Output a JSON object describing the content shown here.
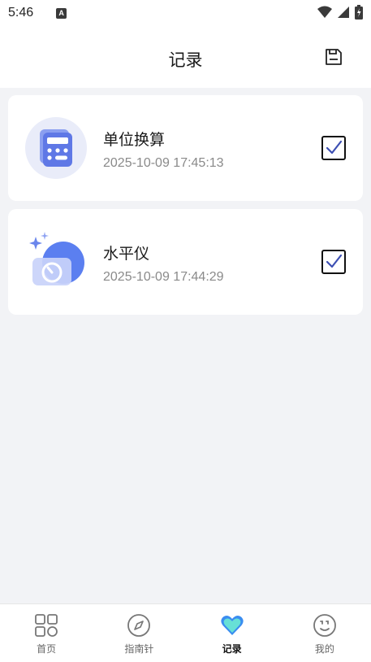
{
  "status_bar": {
    "time": "5:46",
    "notification_badge": "A"
  },
  "header": {
    "title": "记录",
    "save_icon": "save-icon"
  },
  "records": [
    {
      "title": "单位换算",
      "timestamp": "2025-10-09 17:45:13",
      "icon": "calculator-icon",
      "checked": true
    },
    {
      "title": "水平仪",
      "timestamp": "2025-10-09 17:44:29",
      "icon": "level-icon",
      "checked": true
    }
  ],
  "tabbar": {
    "tabs": [
      {
        "label": "首页",
        "icon": "home-grid-icon",
        "active": false
      },
      {
        "label": "指南针",
        "icon": "compass-icon",
        "active": false
      },
      {
        "label": "记录",
        "icon": "heart-icon",
        "active": true
      },
      {
        "label": "我的",
        "icon": "smile-icon",
        "active": false
      }
    ]
  },
  "colors": {
    "accent": "#4a6ee0",
    "background": "#f2f3f6",
    "check": "#3d4fb3"
  }
}
